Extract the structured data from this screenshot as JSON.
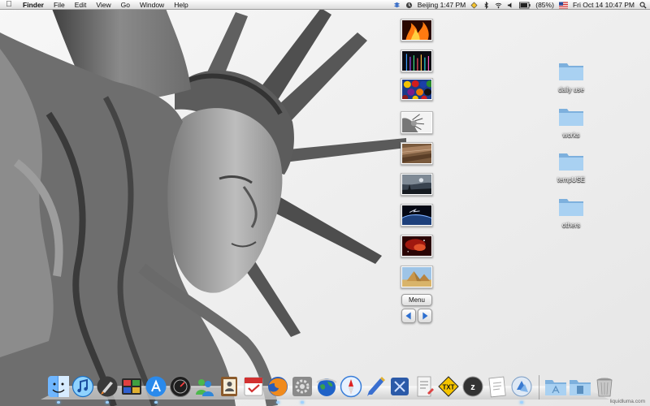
{
  "menubar": {
    "app_name": "Finder",
    "menus": [
      "File",
      "Edit",
      "View",
      "Go",
      "Window",
      "Help"
    ],
    "status": {
      "clock_city": "Beijing 1:47 PM",
      "battery": "(85%)",
      "datetime": "Fri Oct 14  10:47 PM"
    }
  },
  "desktop": {
    "folders": [
      {
        "label": "daily use"
      },
      {
        "label": "works"
      },
      {
        "label": "tempUSE"
      },
      {
        "label": "others"
      }
    ]
  },
  "switcher": {
    "thumbnails": [
      "fire",
      "rainbow-streaks",
      "billiard-balls",
      "statue-of-liberty",
      "brown-texture",
      "dark-sky",
      "earth-space",
      "red-nebula",
      "pyramids"
    ],
    "menu_label": "Menu"
  },
  "dock": {
    "apps": [
      "finder-icon",
      "itunes-icon",
      "launchpad-rocket-icon",
      "photo-booth-icon",
      "app-store-icon",
      "dashboard-icon",
      "messenger-icon",
      "address-book-icon",
      "calendar-icon",
      "firefox-icon",
      "system-preferences-icon",
      "google-earth-icon",
      "safari-icon",
      "pencil-icon",
      "xcode-icon",
      "writer-icon",
      "text-edit-icon",
      "zip-icon",
      "notes-icon",
      "reeder-icon"
    ],
    "stacks": [
      "applications-stack-icon",
      "documents-stack-icon",
      "trash-icon"
    ]
  },
  "watermark": "liquidluma.com"
}
